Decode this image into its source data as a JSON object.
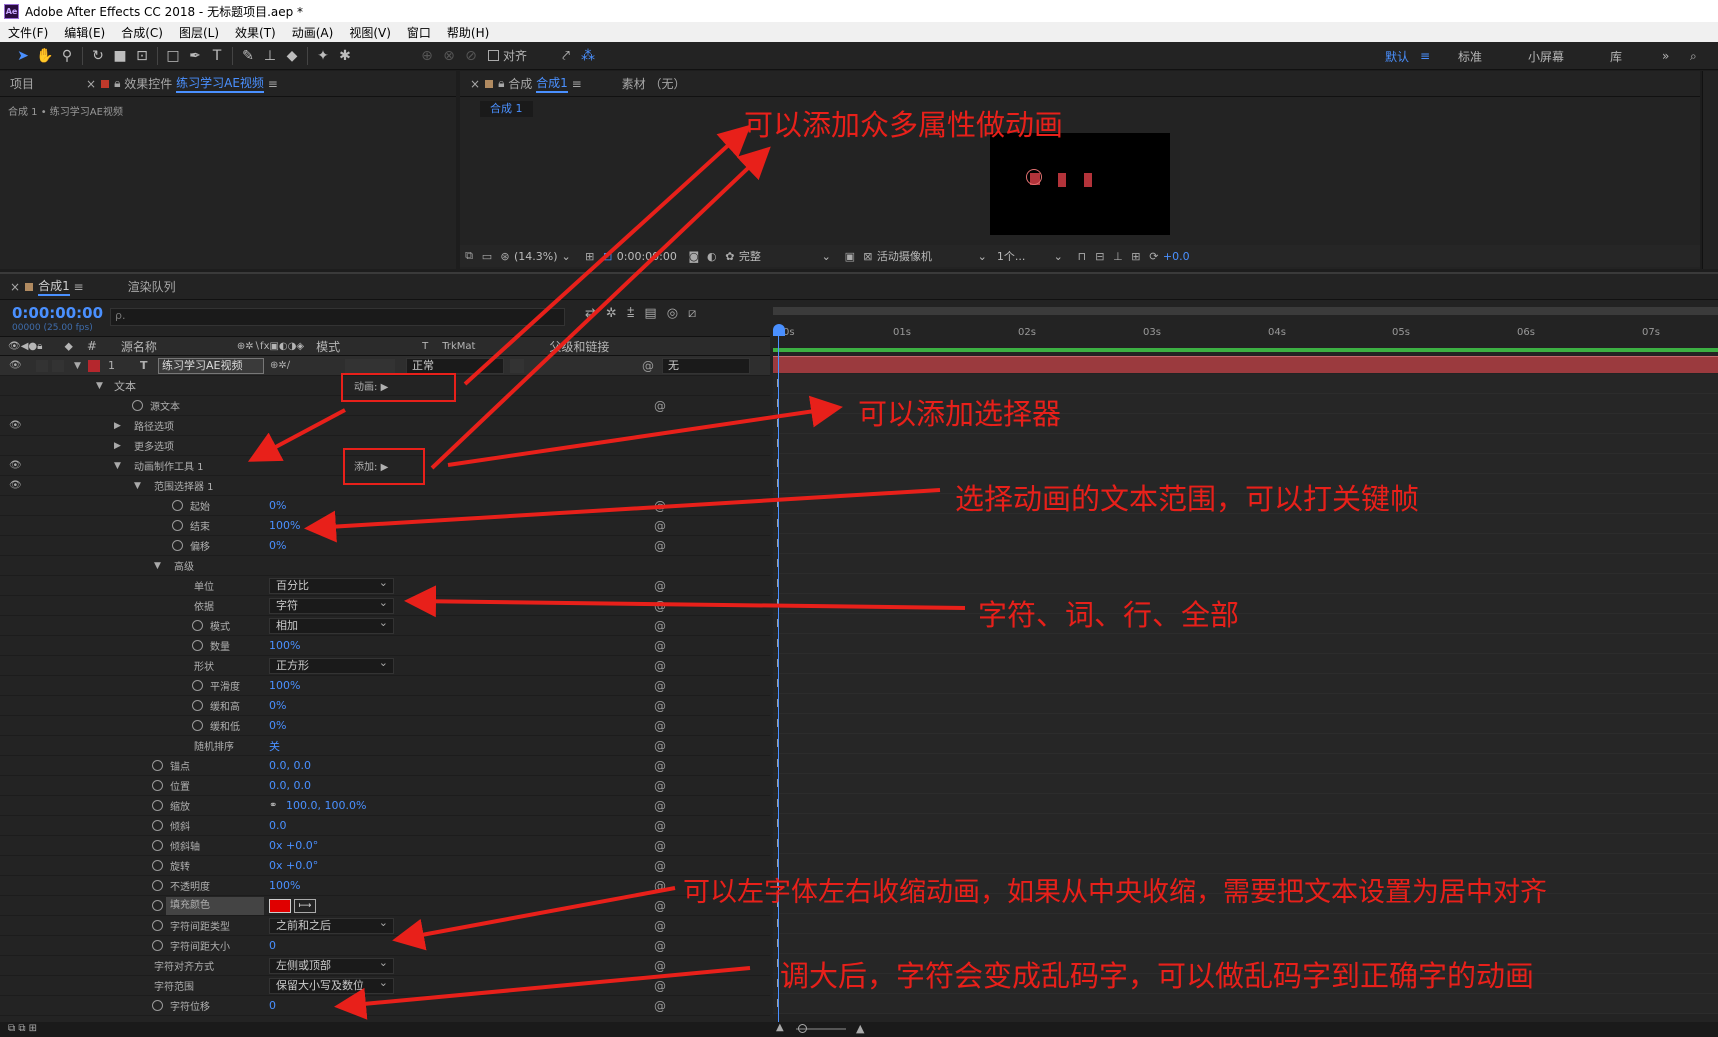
{
  "window": {
    "app_icon": "Ae",
    "title": "Adobe After Effects CC 2018 - 无标题项目.aep *"
  },
  "menu": [
    "文件(F)",
    "编辑(E)",
    "合成(C)",
    "图层(L)",
    "效果(T)",
    "动画(A)",
    "视图(V)",
    "窗口",
    "帮助(H)"
  ],
  "toolbar": {
    "align_label": "对齐",
    "workspaces": [
      "默认",
      "标准",
      "小屏幕",
      "库"
    ],
    "active_workspace": "默认"
  },
  "project_panel": {
    "tab_project": "项目",
    "tab_effects_prefix": "效果控件",
    "tab_effects_target": "练习学习AE视频",
    "breadcrumb": "合成 1 • 练习学习AE视频"
  },
  "comp_panel": {
    "tab_prefix": "合成",
    "tab_name": "合成1",
    "tab_footage": "素材 （无）",
    "comp_chip": "合成 1",
    "zoom": "(14.3%)",
    "time": "0:00:00:00",
    "resolution": "完整",
    "camera": "活动摄像机",
    "views": "1个...",
    "exposure": "+0.0"
  },
  "timeline": {
    "tab_comp": "合成1",
    "tab_render": "渲染队列",
    "timecode": "0:00:00:00",
    "fps": "00000 (25.00 fps)",
    "search_icon_label": "ρ.",
    "columns": {
      "source_name": "源名称",
      "mode": "模式",
      "trkmat": "TrkMat",
      "parent": "父级和链接"
    },
    "ruler": [
      "0s",
      "01s",
      "02s",
      "03s",
      "04s",
      "05s",
      "06s",
      "07s"
    ],
    "layer": {
      "num": "1",
      "type": "T",
      "name": "练习学习AE视频",
      "mode": "正常",
      "parent": "无"
    },
    "rows": {
      "text": "文本",
      "animate_label": "动画:",
      "source_text": "源文本",
      "path_options": "路径选项",
      "more_options": "更多选项",
      "animator": "动画制作工具 1",
      "add_label": "添加:",
      "range_selector": "范围选择器 1",
      "start": {
        "label": "起始",
        "value": "0%"
      },
      "end": {
        "label": "结束",
        "value": "100%"
      },
      "offset": {
        "label": "偏移",
        "value": "0%"
      },
      "advanced": "高级",
      "units": {
        "label": "单位",
        "value": "百分比"
      },
      "based_on": {
        "label": "依据",
        "value": "字符"
      },
      "mode": {
        "label": "模式",
        "value": "相加"
      },
      "amount": {
        "label": "数量",
        "value": "100%"
      },
      "shape": {
        "label": "形状",
        "value": "正方形"
      },
      "smoothness": {
        "label": "平滑度",
        "value": "100%"
      },
      "ease_high": {
        "label": "缓和高",
        "value": "0%"
      },
      "ease_low": {
        "label": "缓和低",
        "value": "0%"
      },
      "randomize": {
        "label": "随机排序",
        "value": "关"
      },
      "anchor": {
        "label": "锚点",
        "value": "0.0, 0.0"
      },
      "position": {
        "label": "位置",
        "value": "0.0, 0.0"
      },
      "scale": {
        "label": "缩放",
        "value": "100.0, 100.0%"
      },
      "skew": {
        "label": "倾斜",
        "value": "0.0"
      },
      "skew_axis": {
        "label": "倾斜轴",
        "value": "0x +0.0°"
      },
      "rotation": {
        "label": "旋转",
        "value": "0x +0.0°"
      },
      "opacity": {
        "label": "不透明度",
        "value": "100%"
      },
      "fill_color": {
        "label": "填充颜色",
        "value": "#e00000"
      },
      "tracking_type": {
        "label": "字符间距类型",
        "value": "之前和之后"
      },
      "tracking_amount": {
        "label": "字符间距大小",
        "value": "0"
      },
      "char_alignment": {
        "label": "字符对齐方式",
        "value": "左侧或顶部"
      },
      "char_range": {
        "label": "字符范围",
        "value": "保留大小写及数位"
      },
      "char_offset": {
        "label": "字符位移",
        "value": "0"
      }
    }
  },
  "annotations": {
    "n1": "可以添加众多属性做动画",
    "n2": "可以添加选择器",
    "n3": "选择动画的文本范围，可以打关键帧",
    "n4": "字符、词、行、全部",
    "n5": "可以左字体左右收缩动画，如果从中央收缩，需要把文本设置为居中对齐",
    "n6": "调大后，字符会变成乱码字，可以做乱码字到正确字的动画",
    "color": "#e8201a"
  },
  "colors": {
    "accent": "#4a90ff",
    "layer_bar": "#9b3a3e",
    "work_area": "#3cb043"
  }
}
